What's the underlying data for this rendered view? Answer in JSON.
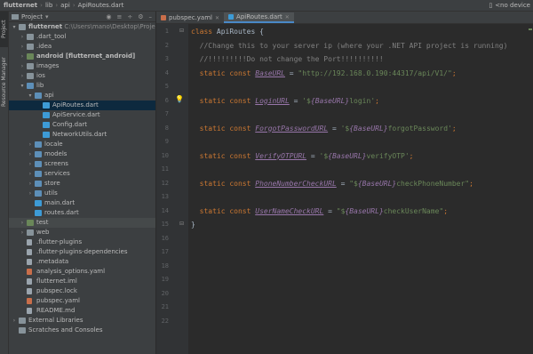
{
  "breadcrumb": [
    "flutternet",
    "lib",
    "api",
    "ApiRoutes.dart"
  ],
  "top_right": {
    "device": "<no device"
  },
  "side_tabs": [
    "Project",
    "Resource Manager"
  ],
  "project_panel": {
    "title": "Project",
    "tree": [
      {
        "label": "flutternet",
        "extra": "C:\\Users\\mano\\Desktop\\Project X\\P",
        "indent": 0,
        "icon": "folder",
        "arrow": "down",
        "bold": true
      },
      {
        "label": ".dart_tool",
        "indent": 1,
        "icon": "folder",
        "arrow": "right"
      },
      {
        "label": ".idea",
        "indent": 1,
        "icon": "folder",
        "arrow": "right"
      },
      {
        "label": "android [flutternet_android]",
        "indent": 1,
        "icon": "folder-green",
        "arrow": "right",
        "bold": true
      },
      {
        "label": "images",
        "indent": 1,
        "icon": "folder",
        "arrow": "right"
      },
      {
        "label": "ios",
        "indent": 1,
        "icon": "folder",
        "arrow": "right"
      },
      {
        "label": "lib",
        "indent": 1,
        "icon": "folder-blue",
        "arrow": "down"
      },
      {
        "label": "api",
        "indent": 2,
        "icon": "folder-blue",
        "arrow": "down"
      },
      {
        "label": "ApiRoutes.dart",
        "indent": 3,
        "icon": "dart",
        "selected": true
      },
      {
        "label": "ApiService.dart",
        "indent": 3,
        "icon": "dart"
      },
      {
        "label": "Config.dart",
        "indent": 3,
        "icon": "dart"
      },
      {
        "label": "NetworkUtils.dart",
        "indent": 3,
        "icon": "dart"
      },
      {
        "label": "locale",
        "indent": 2,
        "icon": "folder-blue",
        "arrow": "right"
      },
      {
        "label": "models",
        "indent": 2,
        "icon": "folder-blue",
        "arrow": "right"
      },
      {
        "label": "screens",
        "indent": 2,
        "icon": "folder-blue",
        "arrow": "right"
      },
      {
        "label": "services",
        "indent": 2,
        "icon": "folder-blue",
        "arrow": "right"
      },
      {
        "label": "store",
        "indent": 2,
        "icon": "folder-blue",
        "arrow": "right"
      },
      {
        "label": "utils",
        "indent": 2,
        "icon": "folder-blue",
        "arrow": "right"
      },
      {
        "label": "main.dart",
        "indent": 2,
        "icon": "dart"
      },
      {
        "label": "routes.dart",
        "indent": 2,
        "icon": "dart"
      },
      {
        "label": "test",
        "indent": 1,
        "icon": "folder-green",
        "arrow": "right",
        "highlight": true
      },
      {
        "label": "web",
        "indent": 1,
        "icon": "folder",
        "arrow": "right"
      },
      {
        "label": ".flutter-plugins",
        "indent": 1,
        "icon": "file"
      },
      {
        "label": ".flutter-plugins-dependencies",
        "indent": 1,
        "icon": "file"
      },
      {
        "label": ".metadata",
        "indent": 1,
        "icon": "file"
      },
      {
        "label": "analysis_options.yaml",
        "indent": 1,
        "icon": "yml"
      },
      {
        "label": "flutternet.iml",
        "indent": 1,
        "icon": "file"
      },
      {
        "label": "pubspec.lock",
        "indent": 1,
        "icon": "file"
      },
      {
        "label": "pubspec.yaml",
        "indent": 1,
        "icon": "yml"
      },
      {
        "label": "README.md",
        "indent": 1,
        "icon": "file"
      },
      {
        "label": "External Libraries",
        "indent": 0,
        "icon": "folder",
        "arrow": "right"
      },
      {
        "label": "Scratches and Consoles",
        "indent": 0,
        "icon": "folder",
        "arrow": "none"
      }
    ]
  },
  "editor": {
    "tabs": [
      {
        "label": "pubspec.yaml",
        "active": false
      },
      {
        "label": "ApiRoutes.dart",
        "active": true
      }
    ],
    "line_numbers": [
      "1",
      "2",
      "3",
      "4",
      "5",
      "6",
      "7",
      "8",
      "9",
      "10",
      "11",
      "12",
      "13",
      "14",
      "15",
      "16",
      "17",
      "18",
      "19",
      "20",
      "21",
      "22"
    ],
    "lines": [
      [
        {
          "t": "class ",
          "c": "kw"
        },
        {
          "t": "ApiRoutes {",
          "c": ""
        }
      ],
      [
        {
          "t": "  //Change this to your server ip (where your .NET API project is running)",
          "c": "cm"
        }
      ],
      [
        {
          "t": "  //!!!!!!!!!Do not change the Port!!!!!!!!!!",
          "c": "cm"
        }
      ],
      [
        {
          "t": "  static const ",
          "c": "kw"
        },
        {
          "t": "BaseURL",
          "c": "fld"
        },
        {
          "t": " = ",
          "c": ""
        },
        {
          "t": "\"http://192.168.0.190:44317/api/V1/\"",
          "c": "str"
        },
        {
          "t": ";",
          "c": "kw"
        }
      ],
      [],
      [
        {
          "t": "  static const ",
          "c": "kw"
        },
        {
          "t": "LoginURL",
          "c": "fld"
        },
        {
          "t": " = ",
          "c": ""
        },
        {
          "t": "'$",
          "c": "str"
        },
        {
          "t": "{BaseURL}",
          "c": "intp"
        },
        {
          "t": "login'",
          "c": "str"
        },
        {
          "t": ";",
          "c": "kw"
        }
      ],
      [],
      [
        {
          "t": "  static const ",
          "c": "kw"
        },
        {
          "t": "ForgotPasswordURL",
          "c": "fld"
        },
        {
          "t": " = ",
          "c": ""
        },
        {
          "t": "'$",
          "c": "str"
        },
        {
          "t": "{BaseURL}",
          "c": "intp"
        },
        {
          "t": "forgotPassword'",
          "c": "str"
        },
        {
          "t": ";",
          "c": "kw"
        }
      ],
      [],
      [
        {
          "t": "  static const ",
          "c": "kw"
        },
        {
          "t": "VerifyOTPURL",
          "c": "fld"
        },
        {
          "t": " = ",
          "c": ""
        },
        {
          "t": "'$",
          "c": "str"
        },
        {
          "t": "{BaseURL}",
          "c": "intp"
        },
        {
          "t": "verifyOTP'",
          "c": "str"
        },
        {
          "t": ";",
          "c": "kw"
        }
      ],
      [],
      [
        {
          "t": "  static const ",
          "c": "kw"
        },
        {
          "t": "PhoneNumberCheckURL",
          "c": "fld"
        },
        {
          "t": " = ",
          "c": ""
        },
        {
          "t": "\"$",
          "c": "str"
        },
        {
          "t": "{BaseURL}",
          "c": "intp"
        },
        {
          "t": "checkPhoneNumber\"",
          "c": "str"
        },
        {
          "t": ";",
          "c": "kw"
        }
      ],
      [],
      [
        {
          "t": "  static const ",
          "c": "kw"
        },
        {
          "t": "UserNameCheckURL",
          "c": "fld"
        },
        {
          "t": " = ",
          "c": ""
        },
        {
          "t": "\"$",
          "c": "str"
        },
        {
          "t": "{BaseURL}",
          "c": "intp"
        },
        {
          "t": "checkUserName\"",
          "c": "str"
        },
        {
          "t": ";",
          "c": "kw"
        }
      ],
      [
        {
          "t": "}",
          "c": ""
        }
      ]
    ],
    "line_rows": [
      0,
      1,
      2,
      3,
      6,
      6,
      8,
      8,
      10,
      10,
      12,
      12,
      14,
      14,
      15
    ],
    "colors": {
      "keyword": "#cc7832",
      "comment": "#808080",
      "field": "#9876aa",
      "string": "#6a8759",
      "text": "#a9b7c6",
      "selection": "#0d293e"
    }
  }
}
